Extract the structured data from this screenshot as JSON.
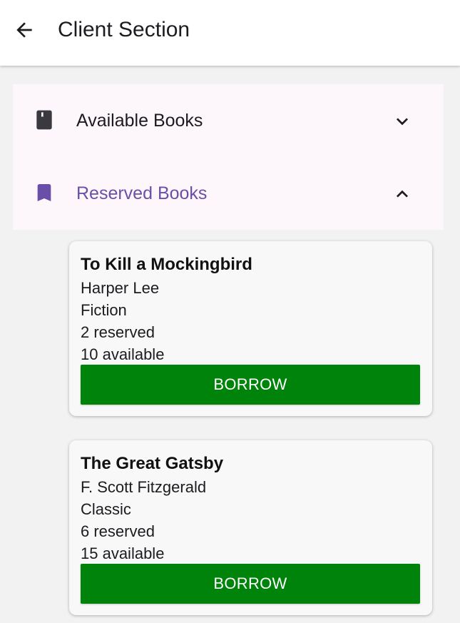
{
  "appbar": {
    "title": "Client Section",
    "back_icon": "arrow-back-icon"
  },
  "menu": {
    "items": [
      {
        "label": "Available Books",
        "icon": "book-icon",
        "expanded": false,
        "color": "#1c1b1f"
      },
      {
        "label": "Reserved Books",
        "icon": "bookmark-icon",
        "expanded": true,
        "color": "#6a4fa8"
      }
    ]
  },
  "books": [
    {
      "title": "To Kill a Mockingbird",
      "author": "Harper Lee",
      "genre": "Fiction",
      "reserved": "2 reserved",
      "available": "10 available",
      "button": "BORROW"
    },
    {
      "title": "The Great Gatsby",
      "author": "F. Scott Fitzgerald",
      "genre": "Classic",
      "reserved": "6 reserved",
      "available": "15 available",
      "button": "BORROW"
    }
  ],
  "colors": {
    "accent": "#6a4fa8",
    "borrow_button": "#00830a",
    "panel_background": "#fdf7fc"
  }
}
